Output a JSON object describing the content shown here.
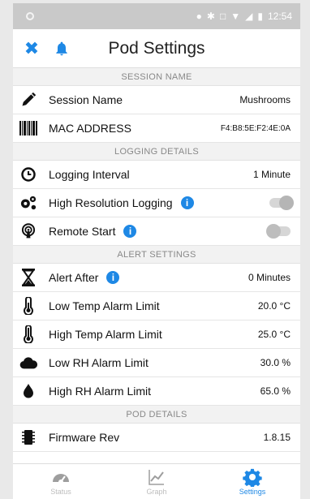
{
  "status_bar": {
    "time": "12:54"
  },
  "app_bar": {
    "title": "Pod Settings",
    "close_icon": "close-icon",
    "bell_icon": "bell-icon"
  },
  "sections": {
    "session": {
      "header": "SESSION NAME"
    },
    "logging": {
      "header": "LOGGING DETAILS"
    },
    "alert": {
      "header": "ALERT SETTINGS"
    },
    "pod": {
      "header": "POD DETAILS"
    }
  },
  "rows": {
    "session_name": {
      "label": "Session Name",
      "value": "Mushrooms",
      "icon": "pencil-icon"
    },
    "mac_address": {
      "label": "MAC ADDRESS",
      "value": "F4:B8:5E:F2:4E:0A",
      "icon": "barcode-icon"
    },
    "logging_interval": {
      "label": "Logging Interval",
      "value": "1 Minute",
      "icon": "clock-icon"
    },
    "high_res_logging": {
      "label": "High Resolution Logging",
      "icon": "gears-icon",
      "toggle": true
    },
    "remote_start": {
      "label": "Remote Start",
      "icon": "broadcast-icon",
      "toggle": false
    },
    "alert_after": {
      "label": "Alert After",
      "value": "0 Minutes",
      "icon": "hourglass-icon"
    },
    "low_temp": {
      "label": "Low Temp Alarm Limit",
      "value": "20.0 °C",
      "icon": "thermometer-icon"
    },
    "high_temp": {
      "label": "High Temp Alarm Limit",
      "value": "25.0 °C",
      "icon": "thermometer-icon"
    },
    "low_rh": {
      "label": "Low RH Alarm Limit",
      "value": "30.0 %",
      "icon": "cloud-icon"
    },
    "high_rh": {
      "label": "High RH Alarm Limit",
      "value": "65.0 %",
      "icon": "droplet-icon"
    },
    "firmware": {
      "label": "Firmware Rev",
      "value": "1.8.15",
      "icon": "chip-icon"
    }
  },
  "info_glyph": "i",
  "bottom_nav": [
    {
      "label": "Status",
      "icon": "gauge-icon"
    },
    {
      "label": "Graph",
      "icon": "chart-icon"
    },
    {
      "label": "Settings",
      "icon": "gear-icon",
      "active": true
    }
  ],
  "colors": {
    "accent": "#1e88e5",
    "status_bar": "#c9c9c9",
    "section_bg": "#f2f2f2"
  }
}
